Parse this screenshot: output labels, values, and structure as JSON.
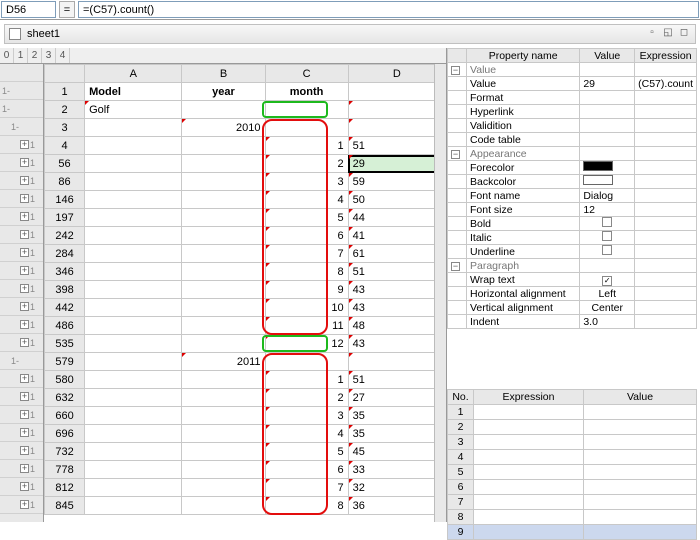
{
  "cell_ref": "D56",
  "formula": "=(C57).count()",
  "window_title": "sheet1",
  "outline_tabs": [
    "0",
    "1",
    "2",
    "3",
    "4"
  ],
  "col_headers": {
    "A": "A",
    "B": "B",
    "C": "C",
    "D": "D"
  },
  "header_row": {
    "A": "Model",
    "B": "year",
    "C": "month",
    "D": ""
  },
  "rows": [
    {
      "n": "2",
      "A": "Golf",
      "B": "",
      "C": "",
      "D": "",
      "g": "1-",
      "lvl": 0
    },
    {
      "n": "3",
      "A": "",
      "B": "2010",
      "C": "",
      "D": "",
      "g": "1-",
      "lvl": 1,
      "green": true
    },
    {
      "n": "4",
      "A": "",
      "B": "",
      "C": "1",
      "D": "51",
      "g": "1+",
      "lvl": 2,
      "redstart": true
    },
    {
      "n": "56",
      "A": "",
      "B": "",
      "C": "2",
      "D": "29",
      "g": "1+",
      "lvl": 2,
      "sel": true
    },
    {
      "n": "86",
      "A": "",
      "B": "",
      "C": "3",
      "D": "59",
      "g": "1+",
      "lvl": 2
    },
    {
      "n": "146",
      "A": "",
      "B": "",
      "C": "4",
      "D": "50",
      "g": "1+",
      "lvl": 2
    },
    {
      "n": "197",
      "A": "",
      "B": "",
      "C": "5",
      "D": "44",
      "g": "1+",
      "lvl": 2
    },
    {
      "n": "242",
      "A": "",
      "B": "",
      "C": "6",
      "D": "41",
      "g": "1+",
      "lvl": 2
    },
    {
      "n": "284",
      "A": "",
      "B": "",
      "C": "7",
      "D": "61",
      "g": "1+",
      "lvl": 2
    },
    {
      "n": "346",
      "A": "",
      "B": "",
      "C": "8",
      "D": "51",
      "g": "1+",
      "lvl": 2
    },
    {
      "n": "398",
      "A": "",
      "B": "",
      "C": "9",
      "D": "43",
      "g": "1+",
      "lvl": 2
    },
    {
      "n": "442",
      "A": "",
      "B": "",
      "C": "10",
      "D": "43",
      "g": "1+",
      "lvl": 2
    },
    {
      "n": "486",
      "A": "",
      "B": "",
      "C": "11",
      "D": "48",
      "g": "1+",
      "lvl": 2
    },
    {
      "n": "535",
      "A": "",
      "B": "",
      "C": "12",
      "D": "43",
      "g": "1+",
      "lvl": 2,
      "redend": true
    },
    {
      "n": "579",
      "A": "",
      "B": "2011",
      "C": "",
      "D": "",
      "g": "1-",
      "lvl": 1,
      "green": true
    },
    {
      "n": "580",
      "A": "",
      "B": "",
      "C": "1",
      "D": "51",
      "g": "1+",
      "lvl": 2,
      "redstart": true
    },
    {
      "n": "632",
      "A": "",
      "B": "",
      "C": "2",
      "D": "27",
      "g": "1+",
      "lvl": 2
    },
    {
      "n": "660",
      "A": "",
      "B": "",
      "C": "3",
      "D": "35",
      "g": "1+",
      "lvl": 2
    },
    {
      "n": "696",
      "A": "",
      "B": "",
      "C": "4",
      "D": "35",
      "g": "1+",
      "lvl": 2
    },
    {
      "n": "732",
      "A": "",
      "B": "",
      "C": "5",
      "D": "45",
      "g": "1+",
      "lvl": 2
    },
    {
      "n": "778",
      "A": "",
      "B": "",
      "C": "6",
      "D": "33",
      "g": "1+",
      "lvl": 2
    },
    {
      "n": "812",
      "A": "",
      "B": "",
      "C": "7",
      "D": "32",
      "g": "1+",
      "lvl": 2
    },
    {
      "n": "845",
      "A": "",
      "B": "",
      "C": "8",
      "D": "36",
      "g": "1+",
      "lvl": 2,
      "redend": true
    }
  ],
  "props_headers": {
    "name": "Property name",
    "value": "Value",
    "expr": "Expression"
  },
  "groups": {
    "value": "Value",
    "appearance": "Appearance",
    "paragraph": "Paragraph"
  },
  "props": {
    "value": {
      "k": "Value",
      "v": "29",
      "e": "(C57).count"
    },
    "format": {
      "k": "Format",
      "v": "",
      "e": ""
    },
    "hyperlink": {
      "k": "Hyperlink",
      "v": "",
      "e": ""
    },
    "validition": {
      "k": "Validition",
      "v": "",
      "e": ""
    },
    "codetable": {
      "k": "Code table",
      "v": "",
      "e": ""
    },
    "forecolor": {
      "k": "Forecolor"
    },
    "backcolor": {
      "k": "Backcolor"
    },
    "fontname": {
      "k": "Font name",
      "v": "Dialog"
    },
    "fontsize": {
      "k": "Font size",
      "v": "12"
    },
    "bold": {
      "k": "Bold"
    },
    "italic": {
      "k": "Italic"
    },
    "underline": {
      "k": "Underline"
    },
    "wraptext": {
      "k": "Wrap text"
    },
    "halign": {
      "k": "Horizontal alignment",
      "v": "Left"
    },
    "valign": {
      "k": "Vertical alignment",
      "v": "Center"
    },
    "indent": {
      "k": "Indent",
      "v": "3.0"
    }
  },
  "expr_headers": {
    "no": "No.",
    "expr": "Expression",
    "val": "Value"
  },
  "expr_rows": [
    "1",
    "2",
    "3",
    "4",
    "5",
    "6",
    "7",
    "8",
    "9"
  ]
}
